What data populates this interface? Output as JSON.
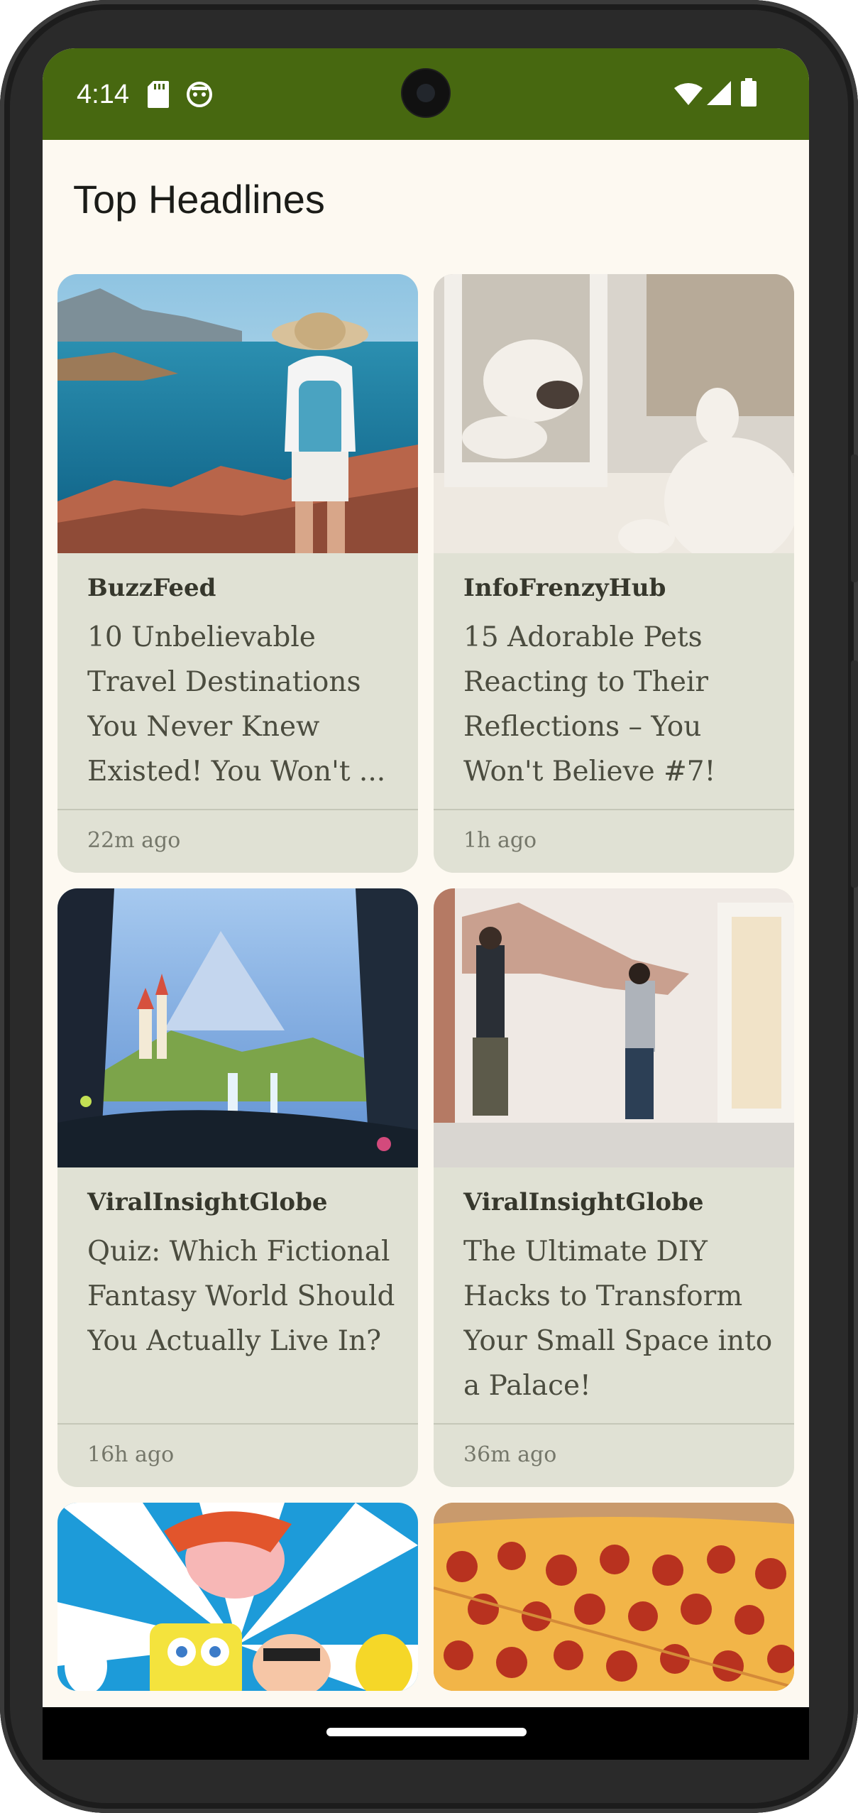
{
  "status_bar": {
    "time": "4:14",
    "left_icons": [
      "sd-card-icon",
      "android-debug-icon"
    ],
    "right_icons": [
      "wifi-icon",
      "signal-icon",
      "battery-icon"
    ],
    "background_color": "#476810"
  },
  "app": {
    "title": "Top Headlines",
    "background_color": "#fdf9f1",
    "card_color": "#e0e1d4"
  },
  "articles": [
    {
      "source": "BuzzFeed",
      "headline": "10 Unbelievable Travel Destinations You Never Knew Existed! You Won't ...",
      "time": "22m ago",
      "image": "woman-with-hat-overlooking-sea-cliff"
    },
    {
      "source": "InfoFrenzyHub",
      "headline": "15 Adorable Pets Reacting to Their Reflections – You Won't Believe #7!",
      "time": "1h ago",
      "image": "bulldog-looking-in-mirror"
    },
    {
      "source": "ViralInsightGlobe",
      "headline": "Quiz: Which Fictional Fantasy World Should You Actually Live In?",
      "time": "16h ago",
      "image": "fantasy-castle-landscape-with-waterfalls"
    },
    {
      "source": "ViralInsightGlobe",
      "headline": "The Ultimate DIY Hacks to Transform Your Small Space into a Palace!",
      "time": "36m ago",
      "image": "two-people-removing-plaster-from-brick-wall"
    },
    {
      "image": "cartoon-characters-collage"
    },
    {
      "image": "pepperoni-pizza-closeup"
    }
  ]
}
